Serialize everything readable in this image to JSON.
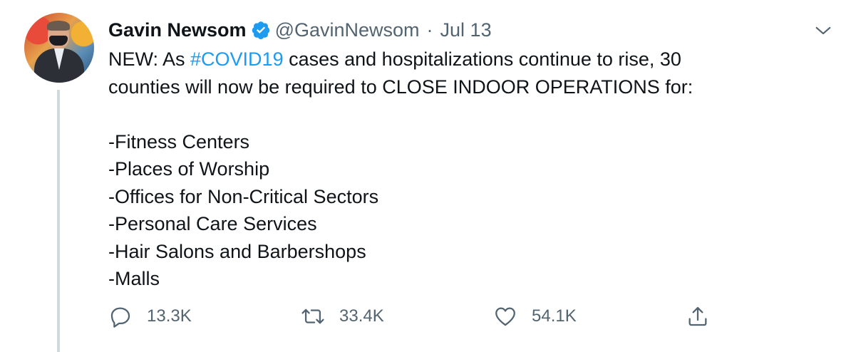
{
  "tweet": {
    "author_name": "Gavin Newsom",
    "handle": "@GavinNewsom",
    "separator": "·",
    "date": "Jul 13",
    "text_line1_prefix": "NEW: As ",
    "hashtag": "#COVID19",
    "text_line1_suffix": " cases and hospitalizations continue to rise, 30",
    "text_line2": "counties will now be required to CLOSE INDOOR OPERATIONS for:",
    "list_items": [
      "-Fitness Centers",
      "-Places of Worship",
      "-Offices for Non-Critical Sectors",
      "-Personal Care Services",
      "-Hair Salons and Barbershops",
      "-Malls"
    ]
  },
  "actions": {
    "reply_count": "13.3K",
    "retweet_count": "33.4K",
    "like_count": "54.1K"
  },
  "icons": {
    "verified": "verified-badge-icon",
    "more": "chevron-down-icon",
    "reply": "reply-icon",
    "retweet": "retweet-icon",
    "like": "heart-icon",
    "share": "share-icon"
  },
  "colors": {
    "accent": "#1d9bf0",
    "text": "#0f1419",
    "muted": "#536471",
    "thread_line": "#cfd9de"
  }
}
